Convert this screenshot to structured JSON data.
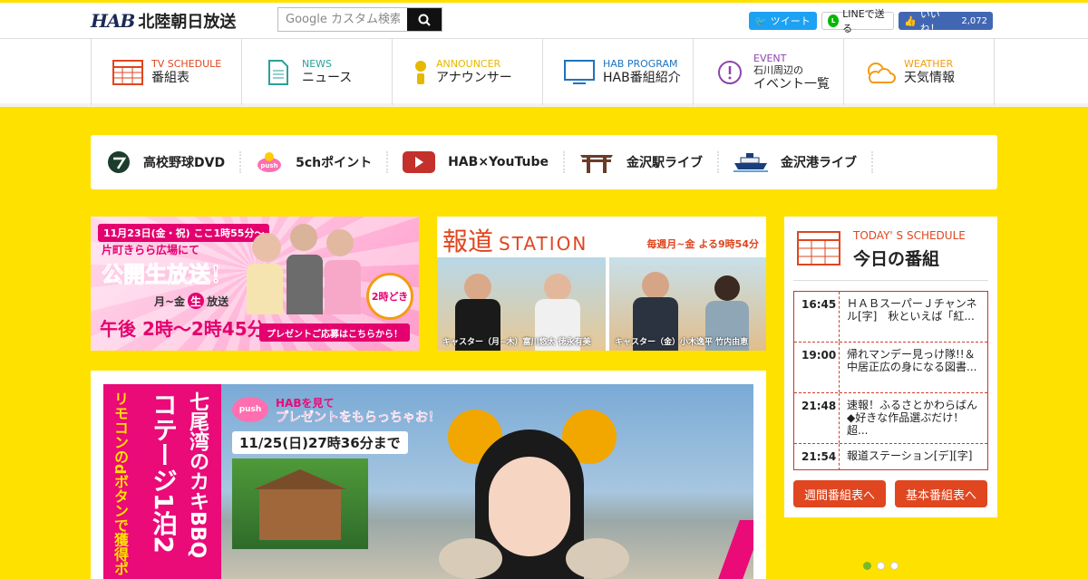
{
  "header": {
    "logo_mark": "HAB",
    "logo_name": "北陸朝日放送",
    "search_placeholder": "Google カスタム検索",
    "share": {
      "tweet": "ツイート",
      "line": "LINEで送る",
      "like": "いいね！",
      "like_count": "2,072"
    }
  },
  "nav": {
    "items": [
      {
        "en": "TV SCHEDULE",
        "jp": "番組表",
        "icon": "tv-schedule-grid-icon",
        "color": "#e0461f"
      },
      {
        "en": "NEWS",
        "jp": "ニュース",
        "icon": "news-document-icon",
        "color": "#2aa198"
      },
      {
        "en": "ANNOUNCER",
        "jp": "アナウンサー",
        "icon": "announcer-person-icon",
        "color": "#e6b800"
      },
      {
        "en": "HAB PROGRAM",
        "jp": "HAB番組紹介",
        "icon": "program-monitor-icon",
        "color": "#1e73be"
      },
      {
        "en": "EVENT",
        "jp1": "石川周辺の",
        "jp2": "イベント一覧",
        "icon": "event-exclamation-icon",
        "color": "#8e44ad"
      },
      {
        "en": "WEATHER",
        "jp": "天気情報",
        "icon": "weather-cloud-icon",
        "color": "#f39c12"
      }
    ]
  },
  "quicklinks": [
    {
      "label": "高校野球DVD",
      "icon": "baseball-dvd-icon"
    },
    {
      "label": "5chポイント",
      "icon": "push-5ch-icon"
    },
    {
      "label": "HAB×YouTube",
      "icon": "youtube-icon"
    },
    {
      "label": "金沢駅ライブ",
      "icon": "kanazawa-station-gate-icon"
    },
    {
      "label": "金沢港ライブ",
      "icon": "kanazawa-port-ship-icon"
    }
  ],
  "banner1": {
    "date": "11月23日(金・祝) ここ1時55分～",
    "place": "片町きらら広場にて",
    "headline": "公開生放送！",
    "days": "月~金",
    "live": "生",
    "broadcast": "放送",
    "time": "午後 2時～2時45分",
    "logo": "2時どき",
    "cta": "プレゼントご応募はこちらから！"
  },
  "banner2": {
    "title_jp": "報道",
    "title_en": "STATION",
    "schedule": "毎週月~金 よる9時54分",
    "caster1": "キャスター（月~木）富川悠太 徳永有美",
    "caster2": "キャスター（金）小木逸平 竹内由恵"
  },
  "promo": {
    "badge": "push",
    "lead1": "HABを見て",
    "lead2": "プレゼントをもらっちゃお！",
    "deadline": "11/25(日)27時36分まで",
    "vertical1": "七尾湾のカキBBQ",
    "vertical2": "コテージ1泊2",
    "vertical3": "リモコンのdボタンで獲得ポ"
  },
  "schedule": {
    "label_en": "TODAY' S SCHEDULE",
    "title": "今日の番組",
    "rows": [
      {
        "time": "16:45",
        "program": "ＨＡＢスーパーＪチャンネル[字]　秋といえば「紅..."
      },
      {
        "time": "19:00",
        "program": "帰れマンデー見っけ隊!!＆中居正広の身になる図書..."
      },
      {
        "time": "21:48",
        "program": "速報！ふるさとかわらばん◆好きな作品選ぶだけ！超..."
      },
      {
        "time": "21:54",
        "program": "報道ステーション[デ][字]"
      }
    ],
    "weekly_button": "週間番組表へ",
    "basic_button": "基本番組表へ"
  }
}
